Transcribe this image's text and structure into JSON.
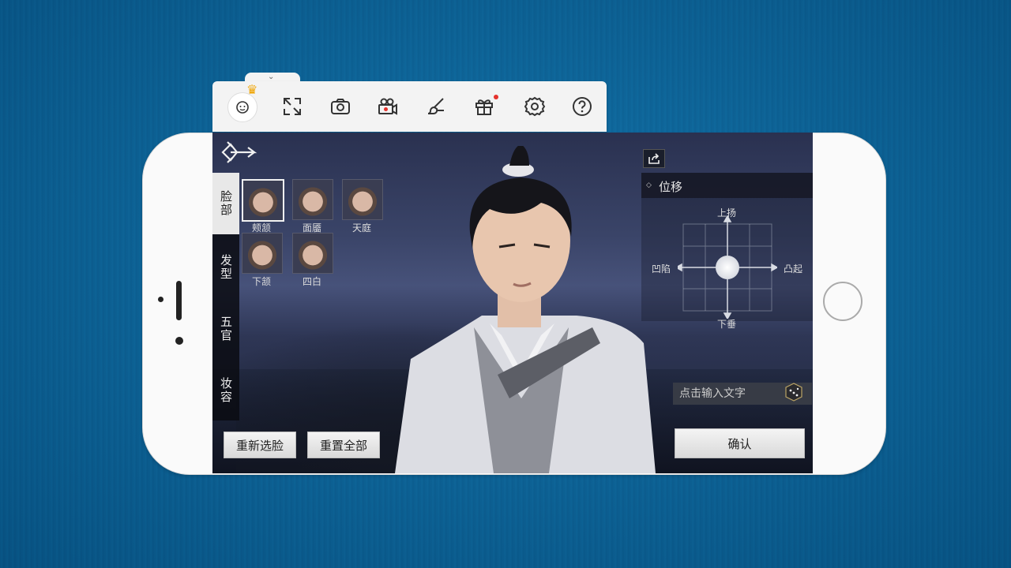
{
  "toolbar": {
    "items": [
      "avatar-icon",
      "fullscreen-icon",
      "camera-icon",
      "video-record-icon",
      "brush-icon",
      "gift-icon",
      "settings-icon",
      "help-icon"
    ]
  },
  "game": {
    "side_tabs": [
      "脸部",
      "发型",
      "五官",
      "妆容"
    ],
    "face_parts": [
      "颊颔",
      "面靥",
      "天庭",
      "下颔",
      "四白"
    ],
    "position_panel": {
      "title": "位移",
      "up": "上扬",
      "down": "下垂",
      "left": "凹陷",
      "right": "凸起"
    },
    "name_input_placeholder": "点击输入文字",
    "buttons": {
      "reselect_face": "重新选脸",
      "reset_all": "重置全部",
      "confirm": "确认"
    }
  }
}
